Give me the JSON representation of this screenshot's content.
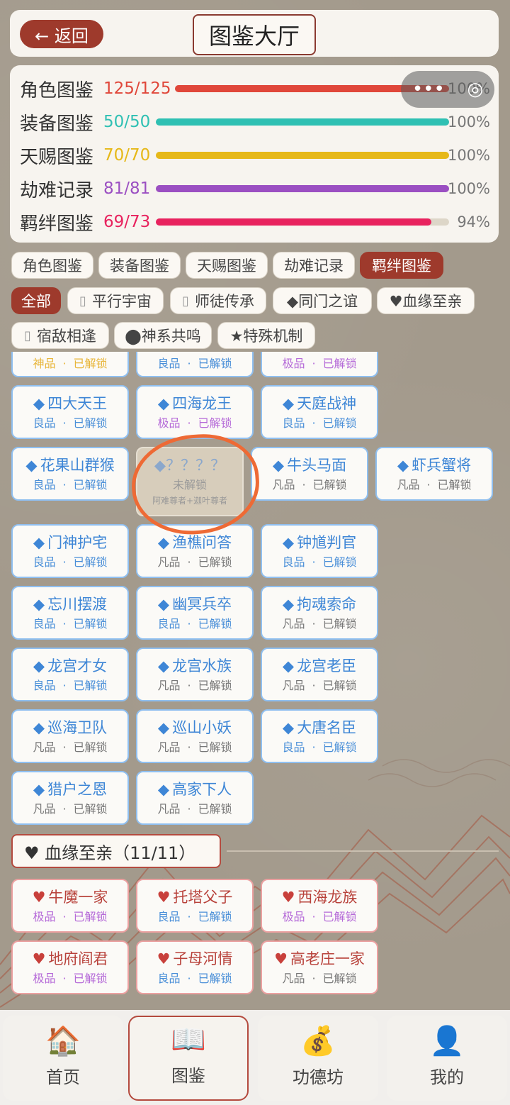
{
  "header": {
    "back_label": "← 返回",
    "title": "图鉴大厅"
  },
  "progress": [
    {
      "label": "角色图鉴",
      "count": "125/125",
      "pct": "100%",
      "value": 1.0,
      "color": "#e0473a"
    },
    {
      "label": "装备图鉴",
      "count": "50/50",
      "pct": "100%",
      "value": 1.0,
      "color": "#2fc0b3"
    },
    {
      "label": "天赐图鉴",
      "count": "70/70",
      "pct": "100%",
      "value": 1.0,
      "color": "#e6b818"
    },
    {
      "label": "劫难记录",
      "count": "81/81",
      "pct": "100%",
      "value": 1.0,
      "color": "#9b4fc2"
    },
    {
      "label": "羁绊图鉴",
      "count": "69/73",
      "pct": "94%",
      "value": 0.94,
      "color": "#e8225e"
    }
  ],
  "mini_program": {
    "more": "•••",
    "close": "◎"
  },
  "tabs": [
    {
      "label": "角色图鉴",
      "active": false
    },
    {
      "label": "装备图鉴",
      "active": false
    },
    {
      "label": "天赐图鉴",
      "active": false
    },
    {
      "label": "劫难记录",
      "active": false
    },
    {
      "label": "羁绊图鉴",
      "active": true
    }
  ],
  "filters": [
    {
      "label": "全部",
      "glyph": "",
      "active": true
    },
    {
      "label": "平行宇宙",
      "glyph": "▯",
      "active": false
    },
    {
      "label": "师徒传承",
      "glyph": "▯",
      "active": false
    },
    {
      "label": "◆同门之谊",
      "glyph": "",
      "active": false
    },
    {
      "label": "♥血缘至亲",
      "glyph": "",
      "active": false
    },
    {
      "label": "宿敌相逢",
      "glyph": "▯",
      "active": false
    },
    {
      "label": "⬤神系共鸣",
      "glyph": "",
      "active": false
    },
    {
      "label": "★特殊机制",
      "glyph": "",
      "active": false
    }
  ],
  "sep": "·",
  "unlocked": "已解锁",
  "partial_row": [
    {
      "quality": "神品",
      "q": "god"
    },
    {
      "quality": "良品",
      "q": "good"
    },
    {
      "quality": "极品",
      "q": "epic"
    }
  ],
  "bond_cards": [
    {
      "icon": "◆",
      "name": "四大天王",
      "quality": "良品",
      "q": "good"
    },
    {
      "icon": "◆",
      "name": "四海龙王",
      "quality": "极品",
      "q": "epic"
    },
    {
      "icon": "◆",
      "name": "天庭战神",
      "quality": "良品",
      "q": "good"
    },
    {
      "icon": "◆",
      "name": "花果山群猴",
      "quality": "良品",
      "q": "good"
    },
    {
      "icon": "◆",
      "name": "牛头马面",
      "quality": "凡品",
      "q": "common"
    },
    {
      "icon": "◆",
      "name": "虾兵蟹将",
      "quality": "凡品",
      "q": "common"
    },
    {
      "icon": "◆",
      "name": "门神护宅",
      "quality": "良品",
      "q": "good"
    },
    {
      "icon": "◆",
      "name": "渔樵问答",
      "quality": "凡品",
      "q": "common"
    },
    {
      "icon": "◆",
      "name": "钟馗判官",
      "quality": "良品",
      "q": "good"
    },
    {
      "icon": "◆",
      "name": "忘川摆渡",
      "quality": "良品",
      "q": "good"
    },
    {
      "icon": "◆",
      "name": "幽冥兵卒",
      "quality": "良品",
      "q": "good"
    },
    {
      "icon": "◆",
      "name": "拘魂索命",
      "quality": "凡品",
      "q": "common"
    },
    {
      "icon": "◆",
      "name": "龙宫才女",
      "quality": "良品",
      "q": "good"
    },
    {
      "icon": "◆",
      "name": "龙宫水族",
      "quality": "凡品",
      "q": "common"
    },
    {
      "icon": "◆",
      "name": "龙宫老臣",
      "quality": "凡品",
      "q": "common"
    },
    {
      "icon": "◆",
      "name": "巡海卫队",
      "quality": "凡品",
      "q": "common"
    },
    {
      "icon": "◆",
      "name": "巡山小妖",
      "quality": "凡品",
      "q": "common"
    },
    {
      "icon": "◆",
      "name": "大唐名臣",
      "quality": "良品",
      "q": "good"
    },
    {
      "icon": "◆",
      "name": "猎户之恩",
      "quality": "凡品",
      "q": "common"
    },
    {
      "icon": "◆",
      "name": "高家下人",
      "quality": "凡品",
      "q": "common"
    }
  ],
  "locked_card": {
    "name": "◆？？？？",
    "status": "未解锁",
    "condition": "阿难尊者+迦叶尊者"
  },
  "kin_section": {
    "title": "♥ 血缘至亲（11/11）"
  },
  "kin_cards": [
    {
      "icon": "♥",
      "name": "牛魔一家",
      "quality": "极品",
      "q": "epic"
    },
    {
      "icon": "♥",
      "name": "托塔父子",
      "quality": "良品",
      "q": "good"
    },
    {
      "icon": "♥",
      "name": "西海龙族",
      "quality": "极品",
      "q": "epic"
    },
    {
      "icon": "♥",
      "name": "地府阎君",
      "quality": "极品",
      "q": "epic"
    },
    {
      "icon": "♥",
      "name": "子母河情",
      "quality": "良品",
      "q": "good"
    },
    {
      "icon": "♥",
      "name": "高老庄一家",
      "quality": "凡品",
      "q": "common"
    }
  ],
  "nav": [
    {
      "label": "首页",
      "icon": "🏠",
      "icon_name": "home-icon",
      "active": false
    },
    {
      "label": "图鉴",
      "icon": "📖",
      "icon_name": "book-icon",
      "active": true
    },
    {
      "label": "功德坊",
      "icon": "💰",
      "icon_name": "money-bag-icon",
      "active": false
    },
    {
      "label": "我的",
      "icon": "👤",
      "icon_name": "user-icon",
      "active": false
    }
  ]
}
